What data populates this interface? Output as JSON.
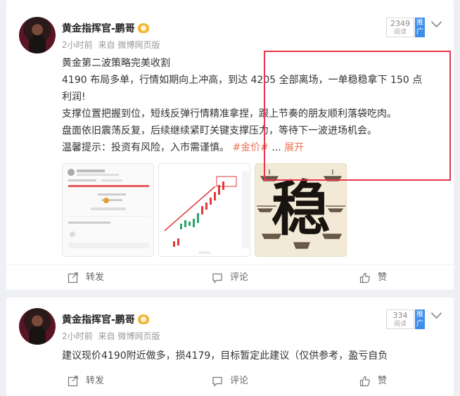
{
  "posts": [
    {
      "author": "黄金指挥官-鹏哥",
      "time": "2小时前",
      "source_prefix": "来自",
      "source": "微博网页版",
      "read_count": "2349",
      "read_label": "阅读",
      "promo_label": "推广",
      "lines": [
        "黄金第二波策略完美收割",
        "4190 布局多单，行情如期向上冲高，到达 4205 全部离场，一单稳稳拿下 150 点",
        "利润!",
        "支撑位置把握到位，短线反弹行情精准拿捏，跟上节奏的朋友顺利落袋吃肉。",
        "盘面依旧震荡反复，后续继续紧盯关键支撑压力，等待下一波进场机会。"
      ],
      "tip_text": "温馨提示：投资有风险，入市需谨慎。",
      "hashtag": "#金价#",
      "ellipsis": "...",
      "expand_label": "展开",
      "thumb3_char": "稳",
      "repost_label": "转发",
      "comment_label": "评论",
      "like_label": "赞"
    },
    {
      "author": "黄金指挥官-鹏哥",
      "time": "2小时前",
      "source_prefix": "来自",
      "source": "微博网页版",
      "read_count": "334",
      "read_label": "阅读",
      "promo_label": "推广",
      "lines": [
        "建议现价4190附近做多，损4179，目标暂定此建议（仅供参考，盈亏自负"
      ],
      "repost_label": "转发",
      "comment_label": "评论",
      "like_label": "赞"
    }
  ],
  "colors": {
    "accent": "#eb7350",
    "promo": "#3f8ee9",
    "highlight_box": "#e8364b"
  },
  "icons": [
    "repost-icon",
    "comment-icon",
    "like-icon",
    "chevron-down-icon",
    "verified-badge-icon"
  ]
}
